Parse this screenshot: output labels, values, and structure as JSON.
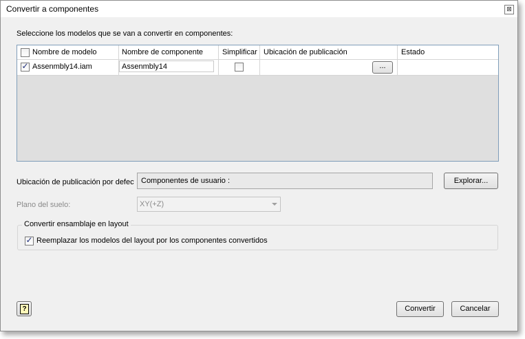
{
  "window": {
    "title": "Convertir a componentes",
    "close_glyph": "⊠"
  },
  "instructions": "Seleccione los modelos que se van a convertir en componentes:",
  "grid": {
    "columns": [
      "Nombre de modelo",
      "Nombre de componente",
      "Simplificar",
      "Ubicación de publicación",
      "Estado"
    ],
    "rows": [
      {
        "checked": true,
        "model_name": "Assenmbly14.iam",
        "component_name": "Assenmbly14",
        "simplify": false,
        "browse_label": "...",
        "status": ""
      }
    ]
  },
  "default_location": {
    "label": "Ubicación de publicación por defecto",
    "value": "Componentes de usuario :",
    "browse_label": "Explorar..."
  },
  "ground_plane": {
    "label": "Plano del suelo:",
    "value": "XY(+Z)"
  },
  "layout_group": {
    "legend": "Convertir ensamblaje en layout",
    "replace_label": "Reemplazar los modelos del layout por los componentes convertidos",
    "replace_checked": true
  },
  "footer": {
    "help_icon": "help-icon",
    "help_glyph": "?",
    "convert_label": "Convertir",
    "cancel_label": "Cancelar"
  }
}
